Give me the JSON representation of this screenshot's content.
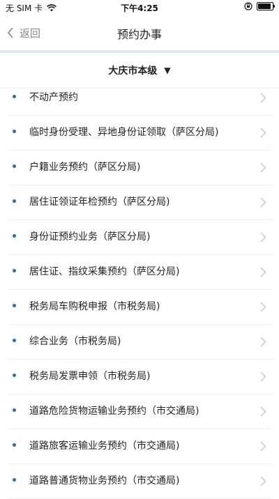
{
  "status_bar": {
    "carrier": "无 SIM 卡",
    "time": "下午4:25",
    "icons": {
      "wifi": "wifi-icon",
      "lock_rotation": "rotation-lock-icon",
      "battery": "battery-icon"
    },
    "battery_level": 0.9
  },
  "nav": {
    "back_label": "返回",
    "title": "预约办事",
    "back_icon": "chevron-left-icon"
  },
  "region": {
    "name": "大庆市本级",
    "dropdown_icon": "▼"
  },
  "items": [
    {
      "label": "不动产预约"
    },
    {
      "label": "临时身份受理、异地身份证领取（萨区分局)"
    },
    {
      "label": "户籍业务预约（萨区分局)"
    },
    {
      "label": "居住证领证年检预约（萨区分局)"
    },
    {
      "label": "身份证预约业务（萨区分局)"
    },
    {
      "label": "居住证、指纹采集预约（萨区分局)"
    },
    {
      "label": "税务局车购税申报（市税务局)"
    },
    {
      "label": "综合业务（市税务局)"
    },
    {
      "label": "税务局发票申领（市税务局)"
    },
    {
      "label": "道路危险货物运输业务预约（市交通局)"
    },
    {
      "label": "道路旅客运输业务预约（市交通局)"
    },
    {
      "label": "道路普通货物业务预约（市交通局)"
    }
  ],
  "colors": {
    "bullet": "#2d6fae",
    "strip": "#dfeaf4",
    "chevron": "#c8c8c8"
  }
}
